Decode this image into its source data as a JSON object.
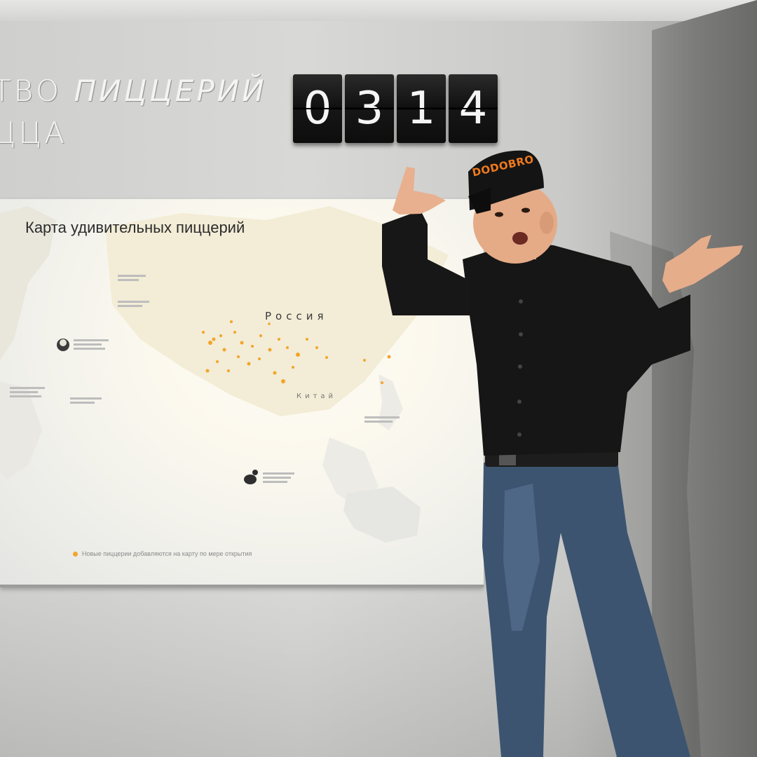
{
  "wall": {
    "heading_line1_plain": "ТВО ",
    "heading_line1_italic": "ПИЦЦЕРИЙ",
    "heading_line2": "ЦЦА"
  },
  "counter": {
    "digits": [
      "0",
      "3",
      "1",
      "4"
    ]
  },
  "map": {
    "title": "Карта удивительных пиццерий",
    "label_russia": "Россия",
    "label_china": "Китай",
    "legend_text": "Новые пиццерии добавляются на карту по мере открытия",
    "accent_color": "#f2a52a"
  },
  "person": {
    "cap_text": "DODOBRO",
    "cap_text_color": "#f07a1c"
  }
}
